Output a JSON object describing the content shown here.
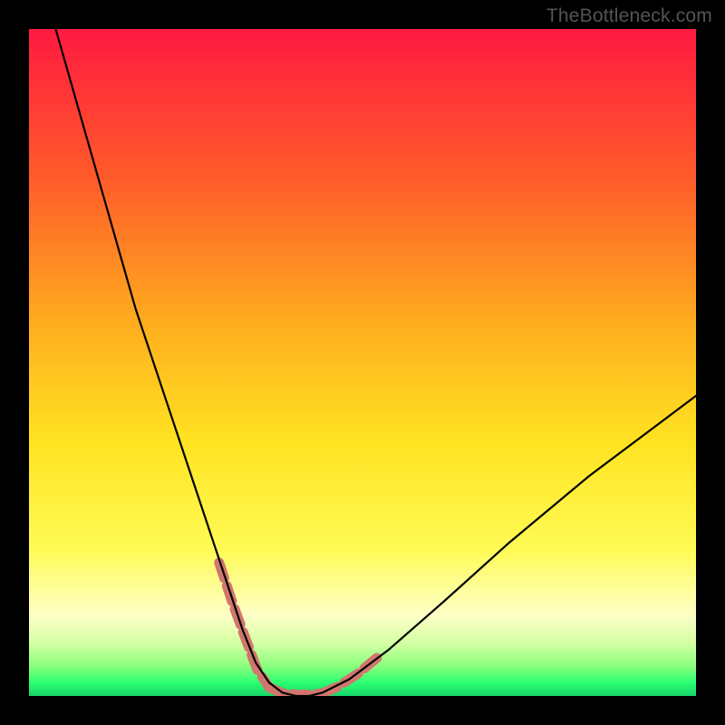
{
  "watermark": {
    "text": "TheBottleneck.com"
  },
  "chart_data": {
    "type": "line",
    "title": "",
    "xlabel": "",
    "ylabel": "",
    "xlim": [
      0,
      100
    ],
    "ylim": [
      0,
      100
    ],
    "grid": false,
    "legend": false,
    "background_gradient": {
      "stops": [
        {
          "offset": 0.0,
          "color": "#ff1a41"
        },
        {
          "offset": 0.22,
          "color": "#ff5a2a"
        },
        {
          "offset": 0.45,
          "color": "#ffb01e"
        },
        {
          "offset": 0.62,
          "color": "#ffe322"
        },
        {
          "offset": 0.78,
          "color": "#fffb55"
        },
        {
          "offset": 0.88,
          "color": "#fdffc7"
        },
        {
          "offset": 0.92,
          "color": "#d5ffa4"
        },
        {
          "offset": 0.955,
          "color": "#8bff7e"
        },
        {
          "offset": 0.98,
          "color": "#2cff71"
        },
        {
          "offset": 1.0,
          "color": "#17d36a"
        }
      ]
    },
    "series": [
      {
        "name": "bottleneck-curve",
        "stroke": "#000000",
        "stroke_width": 2.2,
        "x": [
          4,
          8,
          12,
          16,
          20,
          24,
          28,
          30,
          32,
          34,
          36,
          38,
          40,
          42,
          44,
          48,
          54,
          62,
          72,
          84,
          96,
          100
        ],
        "y": [
          100,
          86,
          72,
          58,
          46,
          34,
          22,
          16,
          10,
          5,
          2,
          0.5,
          0,
          0,
          0.5,
          2.5,
          7,
          14,
          23,
          33,
          42,
          45
        ]
      }
    ],
    "highlight_segments": [
      {
        "name": "left-dashed-segment",
        "stroke": "#d1766e",
        "stroke_width": 11,
        "dash": [
          18,
          9
        ],
        "x": [
          28.5,
          30.5,
          32.5,
          34.2,
          36.0
        ],
        "y": [
          20.0,
          14.0,
          8.5,
          4.0,
          1.3
        ]
      },
      {
        "name": "bottom-dashed-segment",
        "stroke": "#d1766e",
        "stroke_width": 11,
        "dash": [
          18,
          9
        ],
        "x": [
          36.0,
          38.0,
          40.0,
          42.0,
          44.0
        ],
        "y": [
          1.3,
          0.4,
          0.2,
          0.2,
          0.4
        ]
      },
      {
        "name": "right-dashed-segment",
        "stroke": "#d1766e",
        "stroke_width": 11,
        "dash": [
          18,
          9
        ],
        "x": [
          44.0,
          46.5,
          49.5,
          52.5
        ],
        "y": [
          0.4,
          1.5,
          3.5,
          6.0
        ]
      }
    ]
  }
}
